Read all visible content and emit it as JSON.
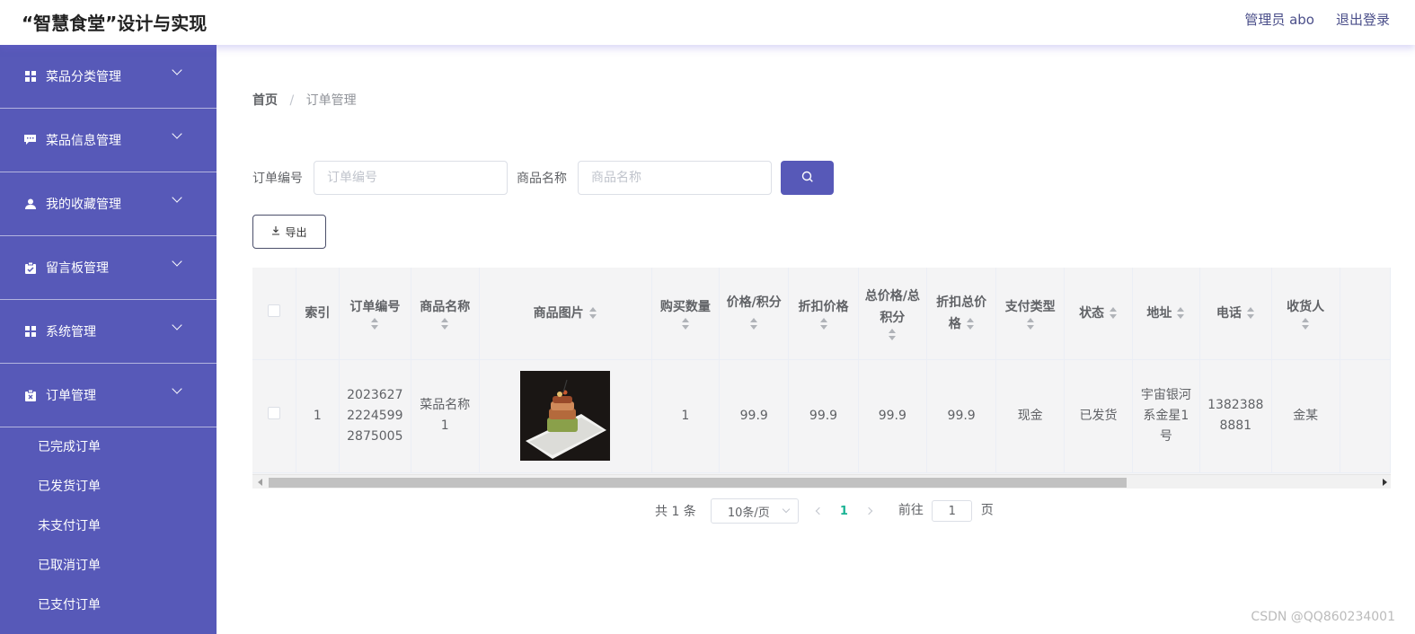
{
  "app": {
    "title": "“智慧食堂”设计与实现"
  },
  "header": {
    "user": "管理员 abo",
    "logout": "退出登录"
  },
  "sidebar": {
    "items": [
      {
        "label": "菜品分类管理",
        "icon": "grid-icon"
      },
      {
        "label": "菜品信息管理",
        "icon": "comment-icon"
      },
      {
        "label": "我的收藏管理",
        "icon": "user-icon"
      },
      {
        "label": "留言板管理",
        "icon": "clipboard-check-icon"
      },
      {
        "label": "系统管理",
        "icon": "grid-icon"
      },
      {
        "label": "订单管理",
        "icon": "clipboard-x-icon"
      }
    ],
    "submenu": [
      "已完成订单",
      "已发货订单",
      "未支付订单",
      "已取消订单",
      "已支付订单"
    ]
  },
  "breadcrumb": {
    "home": "首页",
    "separator": "/",
    "current": "订单管理"
  },
  "search": {
    "order_no_label": "订单编号",
    "order_no_placeholder": "订单编号",
    "goods_name_label": "商品名称",
    "goods_name_placeholder": "商品名称"
  },
  "toolbar": {
    "export_label": "导出"
  },
  "table": {
    "headers": {
      "index": "索引",
      "order_no": "订单编号",
      "goods_name": "商品名称",
      "goods_image": "商品图片",
      "quantity": "购买数量",
      "price_points": "价格/积分",
      "discount_price": "折扣价格",
      "total_price_points": "总价格/总积分",
      "discount_total": "折扣总价格",
      "pay_type": "支付类型",
      "status": "状态",
      "address": "地址",
      "phone": "电话",
      "receiver": "收货人"
    },
    "rows": [
      {
        "index": "1",
        "order_no": "20236272224599287 5005",
        "order_no_lines": [
          "2023627",
          "2224599",
          "2875005"
        ],
        "goods_name_lines": [
          "菜品名称",
          "1"
        ],
        "quantity": "1",
        "price_points": "99.9",
        "discount_price": "99.9",
        "total_price_points": "99.9",
        "discount_total": "99.9",
        "pay_type": "现金",
        "status": "已发货",
        "address_lines": [
          "宇宙银河",
          "系金星1",
          "号"
        ],
        "phone_lines": [
          "1382388",
          "8881"
        ],
        "receiver": "金某"
      }
    ]
  },
  "pagination": {
    "total": "共 1 条",
    "page_size": "10条/页",
    "current_page": "1",
    "goto_label": "前往",
    "goto_value": "1",
    "page_unit": "页"
  },
  "watermark": "CSDN @QQ860234001",
  "colors": {
    "sidebar": "#5759b8",
    "accent": "#5759b8",
    "active_page": "#1ab394"
  }
}
